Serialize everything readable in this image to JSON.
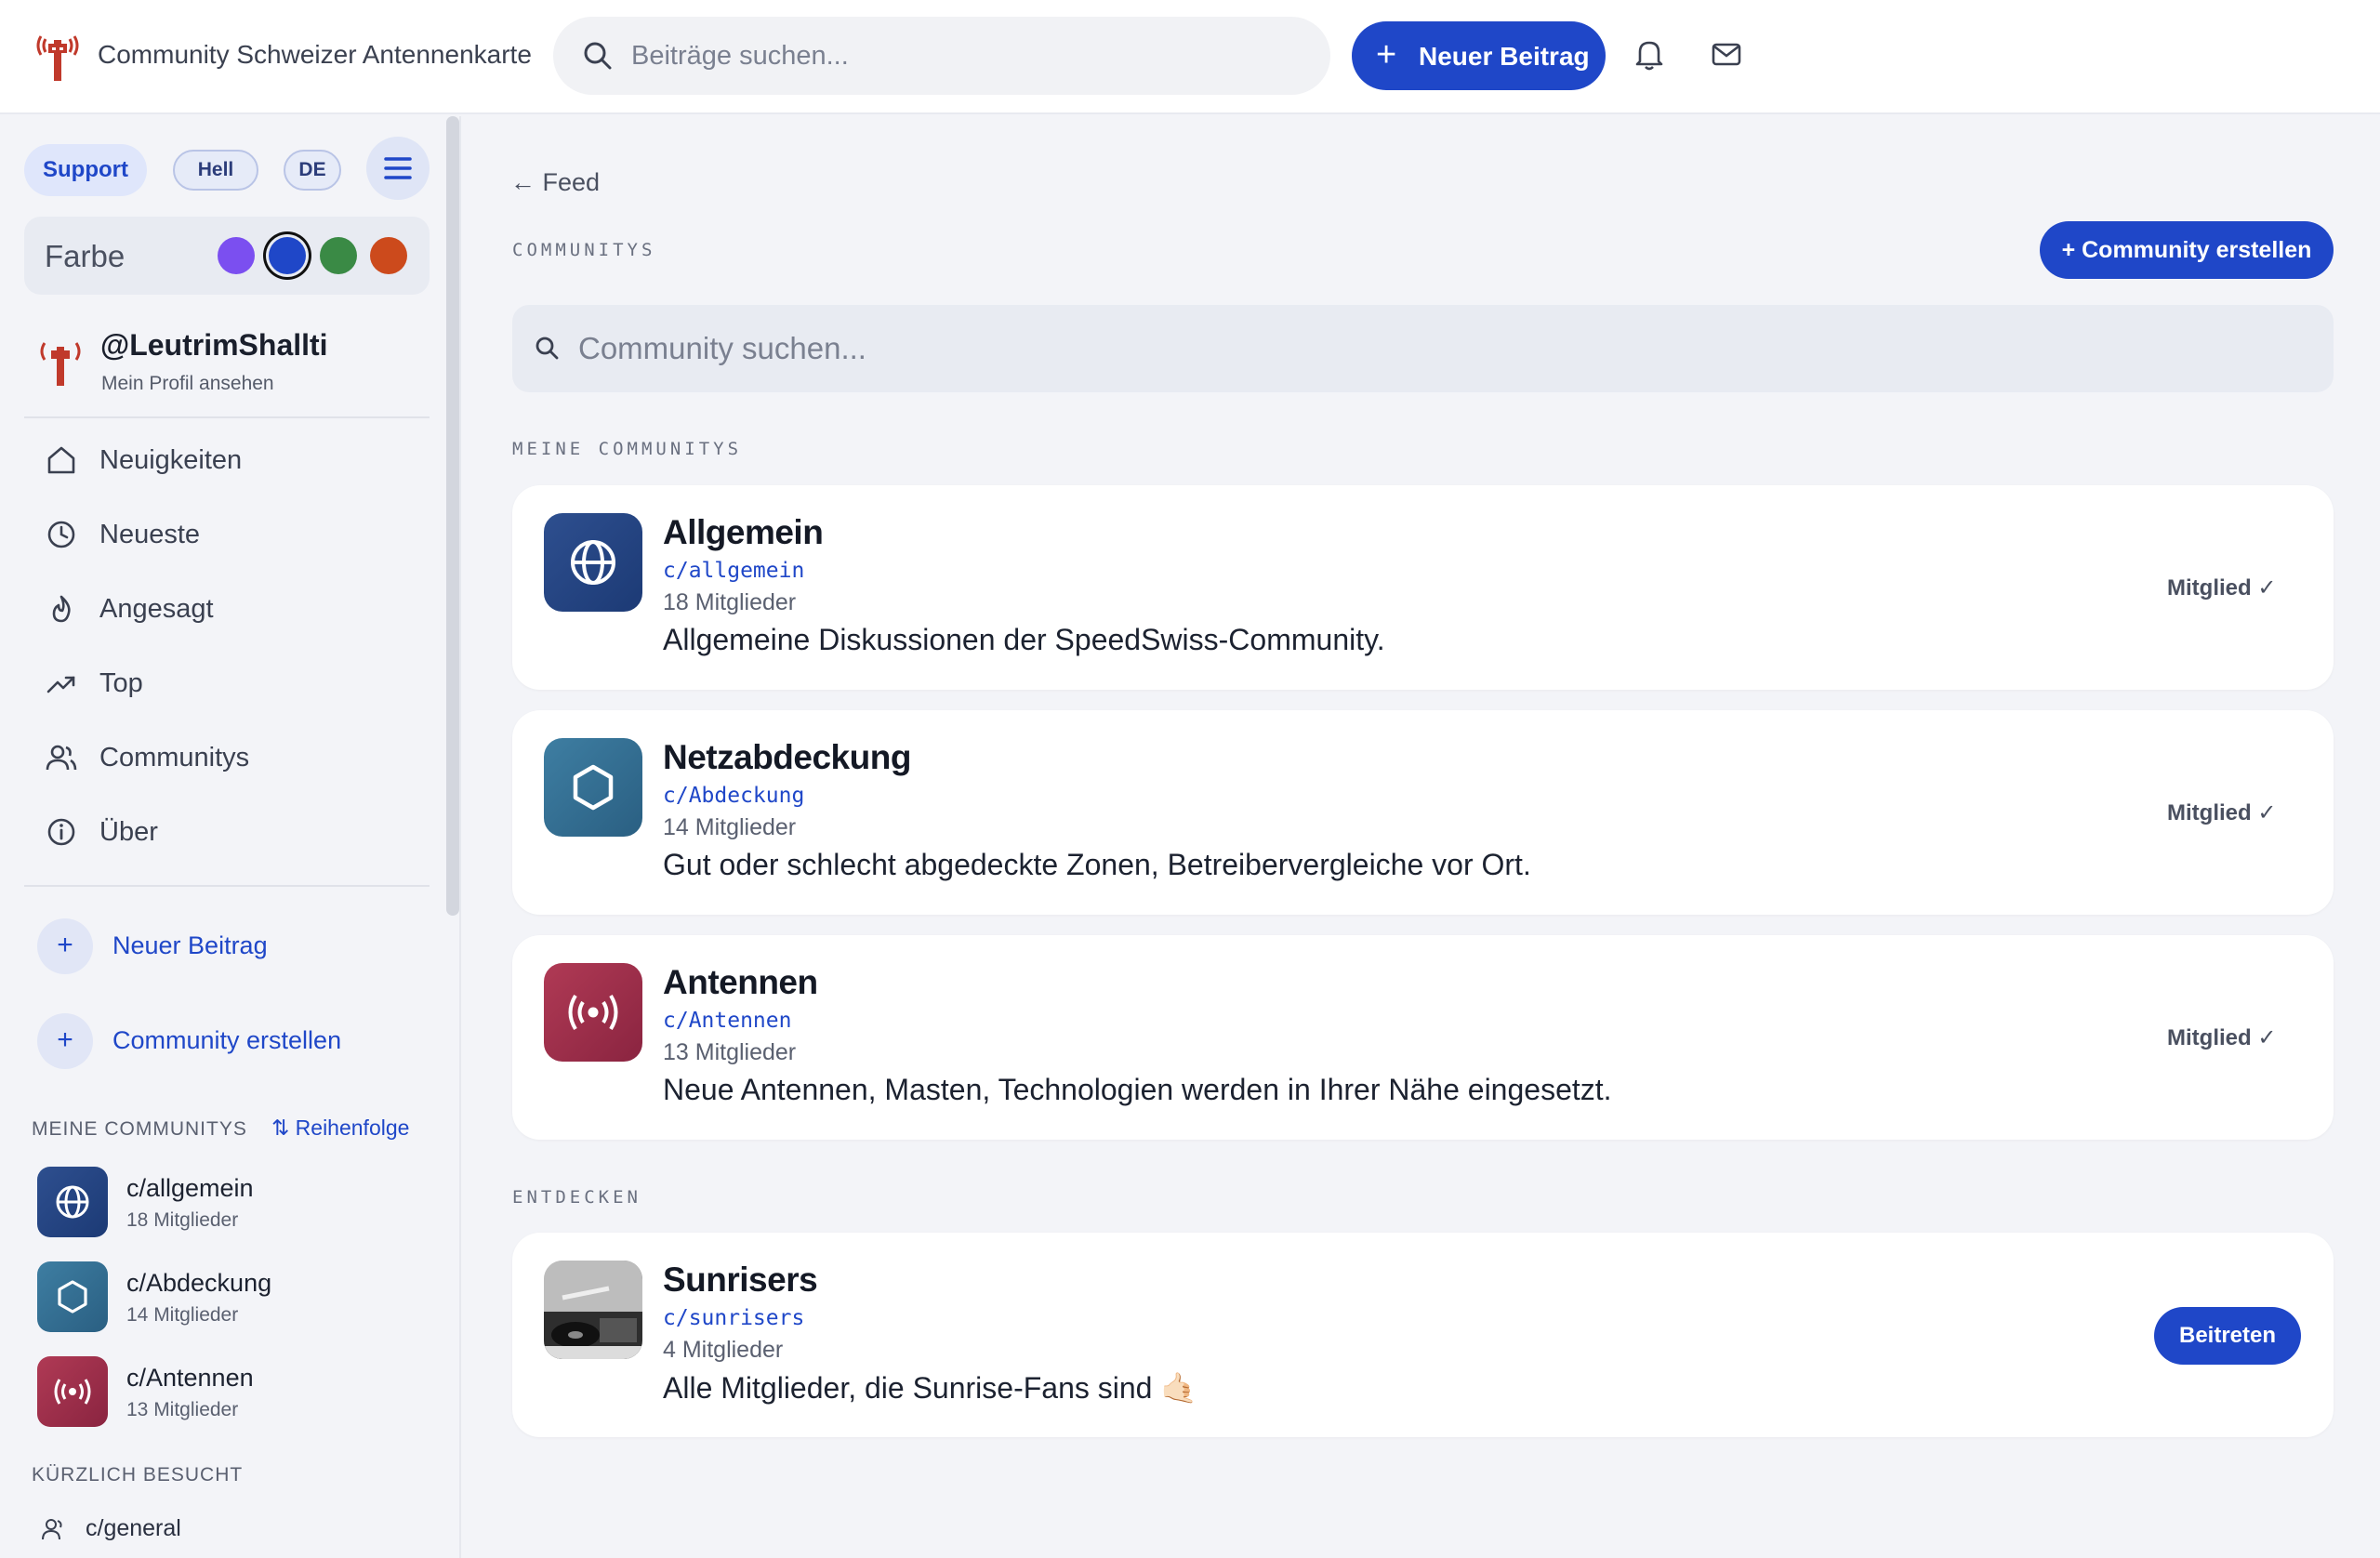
{
  "header": {
    "app_title": "Community Schweizer Antennenkarte",
    "search_placeholder": "Beiträge suchen...",
    "new_post_label": "Neuer Beitrag",
    "icons": [
      "bell-icon",
      "mail-icon",
      "search-icon",
      "antenna-logo"
    ]
  },
  "sidebar": {
    "support": "Support",
    "theme": "Hell",
    "language": "DE",
    "color_label": "Farbe",
    "colors": [
      "#7b4ff0",
      "#1f47c8",
      "#3a8a45",
      "#cc4a1c"
    ],
    "selected_color": "#1f47c8",
    "profile": {
      "handle": "@LeutrimShallti",
      "subtitle": "Mein Profil ansehen"
    },
    "nav": [
      {
        "label": "Neuigkeiten",
        "icon": "home-icon"
      },
      {
        "label": "Neueste",
        "icon": "clock-icon"
      },
      {
        "label": "Angesagt",
        "icon": "flame-icon"
      },
      {
        "label": "Top",
        "icon": "trending-up-icon"
      },
      {
        "label": "Communitys",
        "icon": "users-icon"
      },
      {
        "label": "Über",
        "icon": "info-icon"
      }
    ],
    "actions": [
      {
        "label": "Neuer Beitrag"
      },
      {
        "label": "Community erstellen"
      }
    ],
    "my_communities_label": "MEINE COMMUNITYS",
    "reorder_label": "⇅ Reihenfolge",
    "my_communities": [
      {
        "name": "c/allgemein",
        "members": "18 Mitglieder"
      },
      {
        "name": "c/Abdeckung",
        "members": "14 Mitglieder"
      },
      {
        "name": "c/Antennen",
        "members": "13 Mitglieder"
      }
    ],
    "recent_label": "KÜRZLICH BESUCHT",
    "recent": [
      {
        "name": "c/general"
      }
    ]
  },
  "main": {
    "back_label": "← Feed",
    "section_title": "COMMUNITYS",
    "create_button": "+ Community erstellen",
    "search_placeholder": "Community suchen...",
    "my_communities_label": "MEINE COMMUNITYS",
    "communities": [
      {
        "name": "Allgemein",
        "slug": "c/allgemein",
        "members": "18 Mitglieder",
        "description": "Allgemeine Diskussionen der SpeedSwiss-Community.",
        "status": "Mitglied ✓",
        "icon": "globe-icon"
      },
      {
        "name": "Netzabdeckung",
        "slug": "c/Abdeckung",
        "members": "14 Mitglieder",
        "description": "Gut oder schlecht abgedeckte Zonen, Betreibervergleiche vor Ort.",
        "status": "Mitglied ✓",
        "icon": "hexagon-icon"
      },
      {
        "name": "Antennen",
        "slug": "c/Antennen",
        "members": "13 Mitglieder",
        "description": "Neue Antennen, Masten, Technologien werden in Ihrer Nähe eingesetzt.",
        "status": "Mitglied ✓",
        "icon": "broadcast-icon"
      }
    ],
    "discover_label": "ENTDECKEN",
    "discover": [
      {
        "name": "Sunrisers",
        "slug": "c/sunrisers",
        "members": "4 Mitglieder",
        "description": "Alle Mitglieder, die Sunrise-Fans sind 🤙🏻",
        "action": "Beitreten"
      }
    ]
  }
}
